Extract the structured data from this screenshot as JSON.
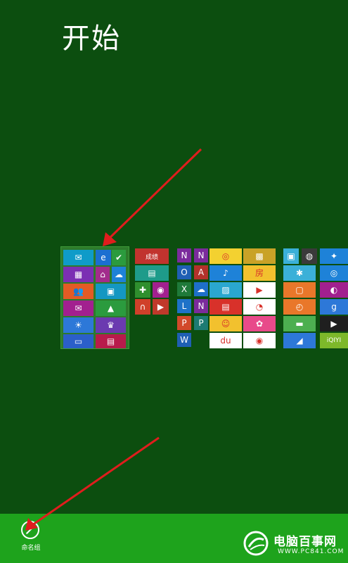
{
  "start_screen": {
    "title": "开始"
  },
  "tiles": {
    "group1": [
      {
        "name": "mail-tile",
        "icon": "mail-icon",
        "glyph": "✉",
        "color": "#0f9bc9",
        "label": ""
      },
      {
        "name": "internet-explorer-tile",
        "icon": "ie-icon",
        "glyph": "e",
        "color": "#1b6fd1",
        "label": ""
      },
      {
        "name": "todo-tile",
        "icon": "checkmark-icon",
        "glyph": "✔",
        "color": "#2b9b3e",
        "label": ""
      },
      {
        "name": "calendar-tile",
        "icon": "calendar-icon",
        "glyph": "▦",
        "color": "#7b2fb3",
        "label": ""
      },
      {
        "name": "maps-tile",
        "icon": "maps-icon",
        "glyph": "⌂",
        "color": "#a22c8c",
        "label": ""
      },
      {
        "name": "skydrive-tile",
        "icon": "cloud-icon",
        "glyph": "☁",
        "color": "#1e82d8",
        "label": ""
      },
      {
        "name": "people-tile",
        "icon": "people-icon",
        "glyph": "👥",
        "color": "#e35b25",
        "label": ""
      },
      {
        "name": "photos-tile",
        "icon": "photos-icon",
        "glyph": "▣",
        "color": "#1497c2",
        "label": ""
      },
      {
        "name": "messaging-tile",
        "icon": "messaging-icon",
        "glyph": "✉",
        "color": "#a2208f",
        "label": ""
      },
      {
        "name": "finance-tile",
        "icon": "finance-icon",
        "glyph": "▲",
        "color": "#2b9b3e",
        "label": ""
      },
      {
        "name": "weather-tile",
        "icon": "weather-icon",
        "glyph": "☀",
        "color": "#2d78d8",
        "label": ""
      },
      {
        "name": "sports-tile",
        "icon": "trophy-icon",
        "glyph": "♛",
        "color": "#6b3ab0",
        "label": ""
      },
      {
        "name": "desktop-tile",
        "icon": "desktop-icon",
        "glyph": "▭",
        "color": "#2b5fc9",
        "label": ""
      },
      {
        "name": "news-tile",
        "icon": "news-icon",
        "glyph": "▤",
        "color": "#b81b4b",
        "label": ""
      }
    ],
    "group2": [
      {
        "name": "app-tile-red",
        "icon": "app-icon",
        "glyph": "",
        "color": "#c1332e",
        "label": "成绩"
      },
      {
        "name": "store-tile",
        "icon": "store-icon",
        "glyph": "▤",
        "color": "#1e9b8a",
        "label": ""
      },
      {
        "name": "xbox-games-tile",
        "icon": "gamepad-icon",
        "glyph": "✚",
        "color": "#2f8f2e",
        "label": ""
      },
      {
        "name": "camera-tile",
        "icon": "camera-icon",
        "glyph": "◉",
        "color": "#a2208f",
        "label": ""
      },
      {
        "name": "music-tile",
        "icon": "headphones-icon",
        "glyph": "∩",
        "color": "#d0402a",
        "label": ""
      },
      {
        "name": "video-tile",
        "icon": "video-icon",
        "glyph": "▶",
        "color": "#c0392b",
        "label": ""
      }
    ],
    "group3_office": [
      {
        "name": "onenote-tile-a",
        "icon": "onenote-icon",
        "glyph": "N",
        "color": "#7b2b9c",
        "label": ""
      },
      {
        "name": "onenote-tile-b",
        "icon": "onenote-icon",
        "glyph": "N",
        "color": "#7b2b9c",
        "label": ""
      },
      {
        "name": "outlook-tile",
        "icon": "outlook-icon",
        "glyph": "O",
        "color": "#1f5fb4",
        "label": ""
      },
      {
        "name": "access-tile",
        "icon": "access-icon",
        "glyph": "A",
        "color": "#b3322b",
        "label": ""
      },
      {
        "name": "excel-tile",
        "icon": "excel-icon",
        "glyph": "X",
        "color": "#1f7a3a",
        "label": ""
      },
      {
        "name": "skydrive-pro-tile",
        "icon": "cloud-icon",
        "glyph": "☁",
        "color": "#1e6fc9",
        "label": ""
      },
      {
        "name": "lync-tile",
        "icon": "lync-icon",
        "glyph": "L",
        "color": "#1e72c8",
        "label": ""
      },
      {
        "name": "onenote-tile-c",
        "icon": "onenote-icon",
        "glyph": "N",
        "color": "#7b2b9c",
        "label": ""
      },
      {
        "name": "powerpoint-tile",
        "icon": "powerpoint-icon",
        "glyph": "P",
        "color": "#d2492a",
        "label": ""
      },
      {
        "name": "publisher-tile",
        "icon": "publisher-icon",
        "glyph": "P",
        "color": "#1d7b73",
        "label": ""
      },
      {
        "name": "word-tile",
        "icon": "word-icon",
        "glyph": "W",
        "color": "#1f5fb4",
        "label": ""
      }
    ],
    "group4": [
      {
        "name": "weibo-tile",
        "icon": "weibo-icon",
        "glyph": "◎",
        "color": "#f3d130",
        "label": ""
      },
      {
        "name": "app-tile-gold",
        "icon": "app-icon",
        "glyph": "▩",
        "color": "#c9a227",
        "label": ""
      },
      {
        "name": "music-app-tile",
        "icon": "music-note-icon",
        "glyph": "♪",
        "color": "#1e82d8",
        "label": ""
      },
      {
        "name": "fang-tile",
        "icon": "house-icon",
        "glyph": "房",
        "color": "#f2c12e",
        "label": ""
      },
      {
        "name": "photo-app-tile",
        "icon": "photo-icon",
        "glyph": "▨",
        "color": "#2aa7cf",
        "label": ""
      },
      {
        "name": "video-app-tile",
        "icon": "play-icon",
        "glyph": "▶",
        "color": "#ffffff",
        "label": ""
      },
      {
        "name": "news-app-tile",
        "icon": "newspaper-icon",
        "glyph": "▤",
        "color": "#d8312a",
        "label": ""
      },
      {
        "name": "app-tile-cyan",
        "icon": "app-icon",
        "glyph": "◔",
        "color": "#ffffff",
        "label": ""
      },
      {
        "name": "smile-app-tile",
        "icon": "smiley-icon",
        "glyph": "☺",
        "color": "#f2c12e",
        "label": ""
      },
      {
        "name": "flower-app-tile",
        "icon": "flower-icon",
        "glyph": "✿",
        "color": "#e84a8a",
        "label": ""
      },
      {
        "name": "baidu-tile",
        "icon": "baidu-icon",
        "glyph": "du",
        "color": "#ffffff",
        "label": ""
      },
      {
        "name": "location-app-tile",
        "icon": "pin-icon",
        "glyph": "◉",
        "color": "#ffffff",
        "label": ""
      }
    ],
    "group5": [
      {
        "name": "app-tile-desktop",
        "icon": "app-icon",
        "glyph": "▣",
        "color": "#3bb0d8",
        "label": ""
      },
      {
        "name": "app-tile-dark",
        "icon": "app-icon",
        "glyph": "◍",
        "color": "#3a3a3a",
        "label": ""
      },
      {
        "name": "app-tile-bird",
        "icon": "bird-icon",
        "glyph": "✦",
        "color": "#1e82d8",
        "label": ""
      },
      {
        "name": "app-tile-settings",
        "icon": "settings-icon",
        "glyph": "✱",
        "color": "#3bb0d8",
        "label": ""
      },
      {
        "name": "app-tile-music",
        "icon": "disc-icon",
        "glyph": "◎",
        "color": "#1e82d8",
        "label": ""
      },
      {
        "name": "app-tile-orange",
        "icon": "app-icon",
        "glyph": "▢",
        "color": "#e9772a",
        "label": ""
      },
      {
        "name": "app-tile-planet",
        "icon": "planet-icon",
        "glyph": "◐",
        "color": "#a2208f",
        "label": ""
      },
      {
        "name": "app-tile-orange2",
        "icon": "app-icon",
        "glyph": "◴",
        "color": "#e9772a",
        "label": ""
      },
      {
        "name": "google-tile",
        "icon": "google-icon",
        "glyph": "g",
        "color": "#2d78d8",
        "label": ""
      },
      {
        "name": "app-tile-green",
        "icon": "app-icon",
        "glyph": "▬",
        "color": "#4caf50",
        "label": ""
      },
      {
        "name": "app-tile-video",
        "icon": "video-icon",
        "glyph": "▶",
        "color": "#1f1f1f",
        "label": ""
      },
      {
        "name": "app-tile-send",
        "icon": "send-icon",
        "glyph": "◢",
        "color": "#2d78d8",
        "label": ""
      },
      {
        "name": "iqiyi-tile",
        "icon": "iqiyi-icon",
        "glyph": "iQIYI",
        "color": "#7db82a",
        "label": ""
      }
    ]
  },
  "appbar": {
    "rename_group_label": "命名组",
    "pencil_icon": "pencil-icon"
  },
  "watermark": {
    "title": "电脑百事网",
    "url": "WWW.PC841.COM"
  }
}
